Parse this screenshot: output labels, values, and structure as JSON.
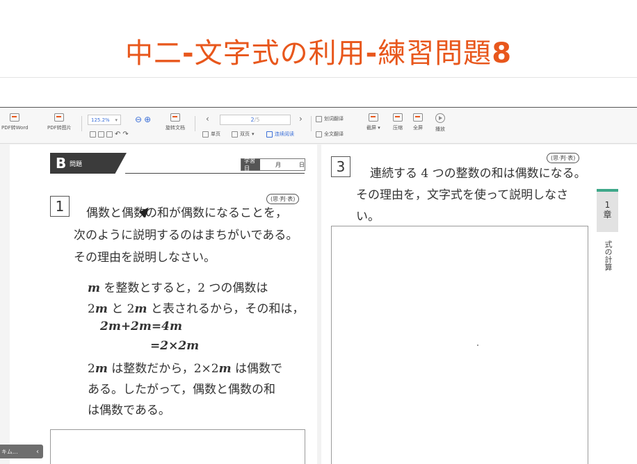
{
  "header": {
    "title_part1": "中二",
    "title_dash1": "-",
    "title_part2": "文字式の利用",
    "title_dash2": "-",
    "title_part3": "練習問題",
    "title_num": "8"
  },
  "toolbar": {
    "pdf_to_word": "PDF转Word",
    "pdf_to_image": "PDF转图片",
    "zoom_value": "125.2%",
    "rotate_doc": "旋转文档",
    "single_page": "单页",
    "double_page": "双页",
    "continuous_read": "连续阅读",
    "page_current": "2",
    "page_total": "/5",
    "word_translate": "划词翻译",
    "full_translate": "全文翻译",
    "screenshot": "截屏",
    "compress": "压缩",
    "fullscreen": "全屏",
    "play": "播放"
  },
  "left_page": {
    "banner_letter": "B",
    "banner_sub": "問題",
    "date_label": "学習日",
    "date_month": "月",
    "date_day": "日",
    "q1_tag": "(思·判·表)",
    "q1_number": "1",
    "q1_line1": "偶数と偶数の和が偶数になることを，",
    "q1_line2": "次のように説明するのはまちがいである。",
    "q1_line3": "その理由を説明しなさい。",
    "ex_line1_m": "m",
    "ex_line1_rest": " を整数とすると，2 つの偶数は",
    "ex_line2_a": "2",
    "ex_line2_m1": "m",
    "ex_line2_b": " と 2",
    "ex_line2_m2": "m",
    "ex_line2_c": " と表されるから，その和は，",
    "ex_eq1": "2m+2m=4m",
    "ex_eq2": "=2×2m",
    "ex_line5_a": "2",
    "ex_line5_m": "m",
    "ex_line5_b": " は整数だから，2×2",
    "ex_line5_m2": "m",
    "ex_line5_c": " は偶数で",
    "ex_line6": "ある。したがって，偶数と偶数の和",
    "ex_line7": "は偶数である。"
  },
  "right_page": {
    "q3_tag": "(思·判·表)",
    "q3_number": "3",
    "q3_line1": "連続する 4 つの整数の和は偶数になる。",
    "q3_line2": "その理由を，文字式を使って説明しなさ",
    "q3_line3": "い。",
    "chapter_num": "1",
    "chapter_label": "章",
    "chapter_sub": "式の計算"
  },
  "bottom_tab": {
    "label": "キム...",
    "chevron": "‹"
  }
}
